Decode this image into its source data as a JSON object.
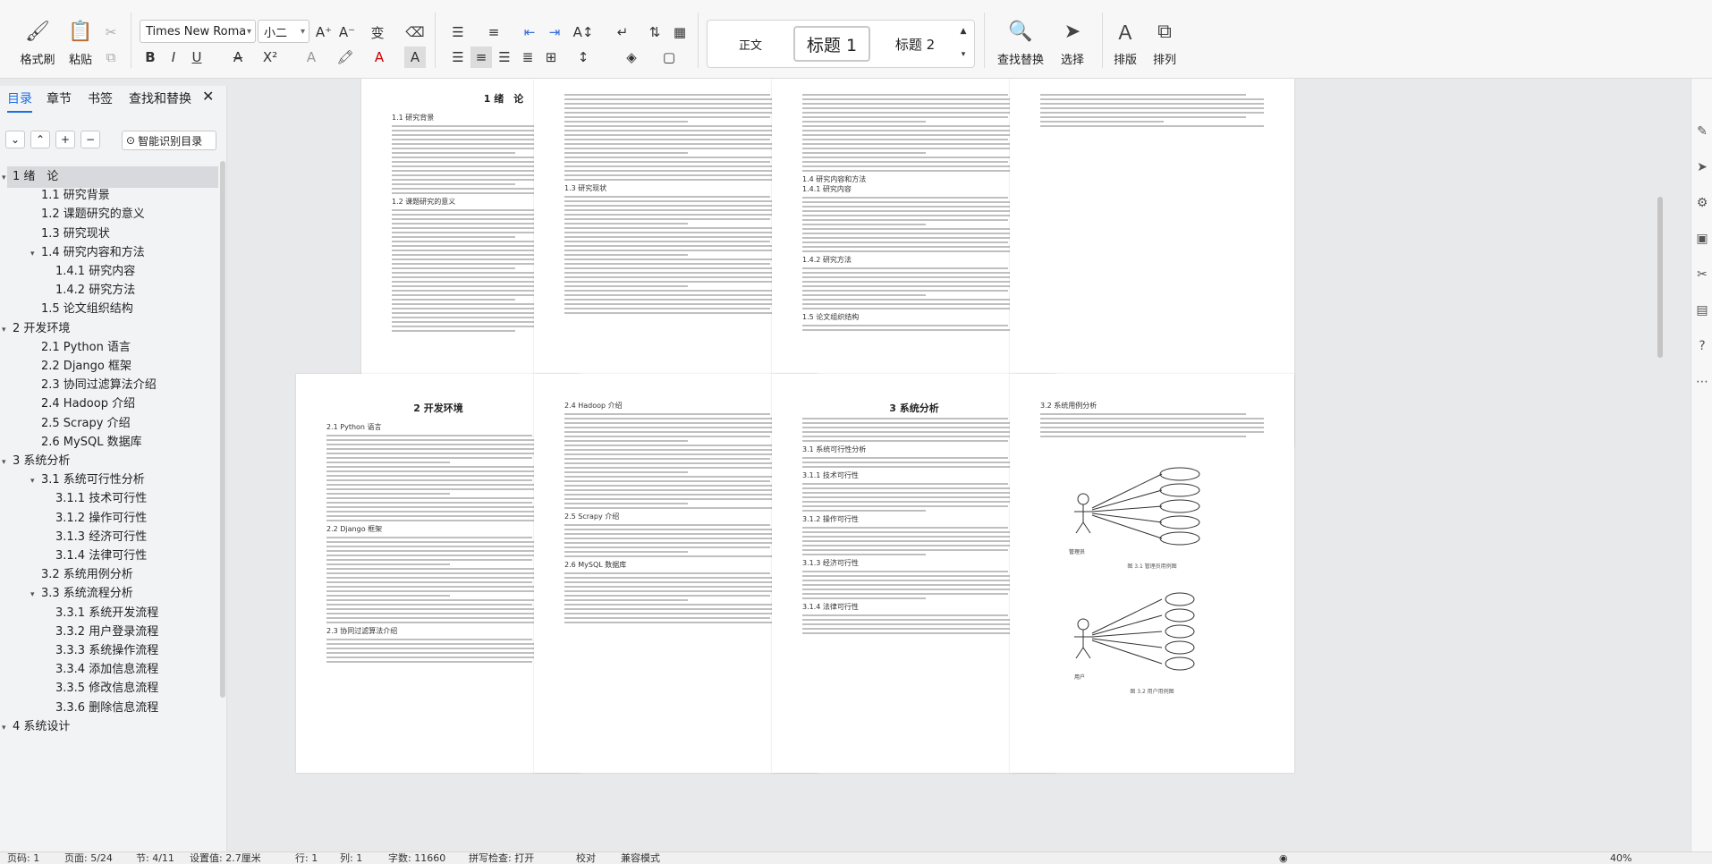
{
  "ribbon": {
    "format_painter": "格式刷",
    "paste": "粘贴",
    "font_name": "Times New Roma",
    "font_size": "小二",
    "styles": {
      "normal": "正文",
      "heading1": "标题 1",
      "heading2": "标题 2"
    },
    "find_replace": "查找替换",
    "select": "选择",
    "layout": "排版",
    "arrange": "排列"
  },
  "nav": {
    "tabs": [
      "目录",
      "章节",
      "书签",
      "查找和替换"
    ],
    "smart_toc": "智能识别目录",
    "toc": [
      {
        "label": "1 绪　论",
        "level": 1,
        "expanded": true,
        "selected": true
      },
      {
        "label": "1.1 研究背景",
        "level": 2
      },
      {
        "label": "1.2 课题研究的意义",
        "level": 2
      },
      {
        "label": "1.3 研究现状",
        "level": 2
      },
      {
        "label": "1.4 研究内容和方法",
        "level": 2,
        "expanded": true
      },
      {
        "label": "1.4.1 研究内容",
        "level": 3
      },
      {
        "label": "1.4.2 研究方法",
        "level": 3
      },
      {
        "label": "1.5 论文组织结构",
        "level": 2
      },
      {
        "label": "2 开发环境",
        "level": 1,
        "expanded": true
      },
      {
        "label": "2.1 Python 语言",
        "level": 2
      },
      {
        "label": "2.2 Django 框架",
        "level": 2
      },
      {
        "label": "2.3 协同过滤算法介绍",
        "level": 2
      },
      {
        "label": "2.4 Hadoop 介绍",
        "level": 2
      },
      {
        "label": "2.5 Scrapy 介绍",
        "level": 2
      },
      {
        "label": "2.6 MySQL 数据库",
        "level": 2
      },
      {
        "label": "3 系统分析",
        "level": 1,
        "expanded": true
      },
      {
        "label": "3.1  系统可行性分析",
        "level": 2,
        "expanded": true
      },
      {
        "label": "3.1.1  技术可行性",
        "level": 3
      },
      {
        "label": "3.1.2  操作可行性",
        "level": 3
      },
      {
        "label": "3.1.3  经济可行性",
        "level": 3
      },
      {
        "label": "3.1.4  法律可行性",
        "level": 3
      },
      {
        "label": "3.2  系统用例分析",
        "level": 2
      },
      {
        "label": "3.3  系统流程分析",
        "level": 2,
        "expanded": true
      },
      {
        "label": "3.3.1  系统开发流程",
        "level": 3
      },
      {
        "label": "3.3.2  用户登录流程",
        "level": 3
      },
      {
        "label": "3.3.3  系统操作流程",
        "level": 3
      },
      {
        "label": "3.3.4  添加信息流程",
        "level": 3
      },
      {
        "label": "3.3.5  修改信息流程",
        "level": 3
      },
      {
        "label": "3.3.6  删除信息流程",
        "level": 3
      },
      {
        "label": "4  系统设计",
        "level": 1,
        "expanded": true
      }
    ]
  },
  "pages": {
    "p1": {
      "title": "1 绪　论",
      "s1": "1.1 研究背景",
      "s2": "1.2 课题研究的意义"
    },
    "p2": {
      "s1": "1.3 研究现状"
    },
    "p3": {
      "s1": "1.4 研究内容和方法",
      "s2": "1.4.1 研究内容",
      "s3": "1.4.2 研究方法",
      "s4": "1.5 论文组织结构"
    },
    "p5": {
      "title": "2 开发环境",
      "s1": "2.1 Python 语言",
      "s2": "2.2 Django 框架",
      "s3": "2.3 协同过滤算法介绍"
    },
    "p6": {
      "s1": "2.4 Hadoop 介绍",
      "s2": "2.5 Scrapy 介绍",
      "s3": "2.6 MySQL 数据库"
    },
    "p7": {
      "title": "3 系统分析",
      "s1": "3.1 系统可行性分析",
      "s2": "3.1.1 技术可行性",
      "s3": "3.1.2 操作可行性",
      "s4": "3.1.3 经济可行性",
      "s5": "3.1.4 法律可行性"
    },
    "p8": {
      "s1": "3.2 系统用例分析",
      "actor1": "管理员",
      "actor2": "用户",
      "cap1": "图 3.1 管理员用例图",
      "cap2": "图 3.2 用户用例图"
    }
  },
  "status": {
    "page": "页码: 1",
    "pages": "页面: 5/24",
    "section": "节: 4/11",
    "setting": "设置值: 2.7厘米",
    "row": "行: 1",
    "col": "列: 1",
    "words": "字数: 11660",
    "spell": "拼写检查: 打开",
    "proof": "校对",
    "compat": "兼容模式",
    "zoom": "40%"
  }
}
